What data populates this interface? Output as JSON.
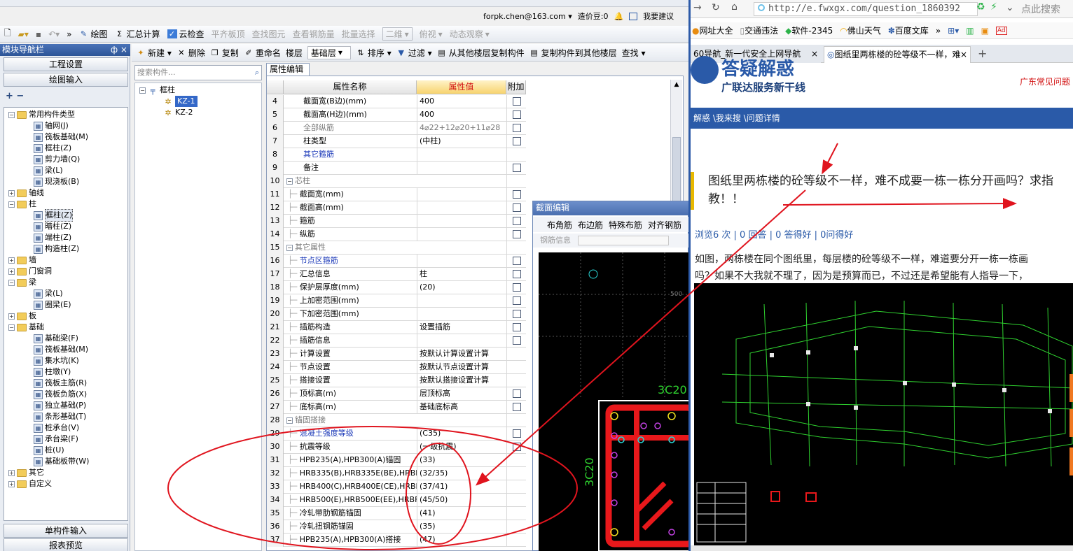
{
  "top_bar": {
    "account": "forpk.chen@163.com ▾",
    "credits": "造价豆:0",
    "suggest": "我要建议"
  },
  "toolbar1": {
    "items": [
      "绘图",
      "汇总计算",
      "云检查",
      "平齐板顶",
      "查找图元",
      "查看钢筋量",
      "批量选择",
      "二维",
      "俯视",
      "动态观察"
    ]
  },
  "nav": {
    "title": "模块导航栏",
    "pin": "ф ×",
    "buttons": [
      "工程设置",
      "绘图输入"
    ],
    "bottom_buttons": [
      "单构件输入",
      "报表预览"
    ],
    "tree": [
      {
        "label": "常用构件类型",
        "level": 0,
        "type": "folder",
        "toggle": "−"
      },
      {
        "label": "轴网(J)",
        "level": 1,
        "type": "item"
      },
      {
        "label": "筏板基础(M)",
        "level": 1,
        "type": "item"
      },
      {
        "label": "框柱(Z)",
        "level": 1,
        "type": "item"
      },
      {
        "label": "剪力墙(Q)",
        "level": 1,
        "type": "item"
      },
      {
        "label": "梁(L)",
        "level": 1,
        "type": "item"
      },
      {
        "label": "现浇板(B)",
        "level": 1,
        "type": "item"
      },
      {
        "label": "轴线",
        "level": 0,
        "type": "folder",
        "toggle": "+"
      },
      {
        "label": "柱",
        "level": 0,
        "type": "folder",
        "toggle": "−"
      },
      {
        "label": "框柱(Z)",
        "level": 1,
        "type": "item",
        "selected": true
      },
      {
        "label": "暗柱(Z)",
        "level": 1,
        "type": "item"
      },
      {
        "label": "端柱(Z)",
        "level": 1,
        "type": "item"
      },
      {
        "label": "构造柱(Z)",
        "level": 1,
        "type": "item"
      },
      {
        "label": "墙",
        "level": 0,
        "type": "folder",
        "toggle": "+"
      },
      {
        "label": "门窗洞",
        "level": 0,
        "type": "folder",
        "toggle": "+"
      },
      {
        "label": "梁",
        "level": 0,
        "type": "folder",
        "toggle": "−"
      },
      {
        "label": "梁(L)",
        "level": 1,
        "type": "item"
      },
      {
        "label": "圈梁(E)",
        "level": 1,
        "type": "item"
      },
      {
        "label": "板",
        "level": 0,
        "type": "folder",
        "toggle": "+"
      },
      {
        "label": "基础",
        "level": 0,
        "type": "folder",
        "toggle": "−"
      },
      {
        "label": "基础梁(F)",
        "level": 1,
        "type": "item"
      },
      {
        "label": "筏板基础(M)",
        "level": 1,
        "type": "item"
      },
      {
        "label": "集水坑(K)",
        "level": 1,
        "type": "item"
      },
      {
        "label": "柱墩(Y)",
        "level": 1,
        "type": "item"
      },
      {
        "label": "筏板主筋(R)",
        "level": 1,
        "type": "item"
      },
      {
        "label": "筏板负筋(X)",
        "level": 1,
        "type": "item"
      },
      {
        "label": "独立基础(P)",
        "level": 1,
        "type": "item"
      },
      {
        "label": "条形基础(T)",
        "level": 1,
        "type": "item"
      },
      {
        "label": "桩承台(V)",
        "level": 1,
        "type": "item"
      },
      {
        "label": "承台梁(F)",
        "level": 1,
        "type": "item"
      },
      {
        "label": "桩(U)",
        "level": 1,
        "type": "item"
      },
      {
        "label": "基础板带(W)",
        "level": 1,
        "type": "item"
      },
      {
        "label": "其它",
        "level": 0,
        "type": "folder",
        "toggle": "+"
      },
      {
        "label": "自定义",
        "level": 0,
        "type": "folder",
        "toggle": "+"
      }
    ]
  },
  "toolbar2": {
    "items": [
      "新建 ▾",
      "删除",
      "复制",
      "重命名",
      "楼层",
      "基础层",
      "排序 ▾",
      "过滤 ▾",
      "从其他楼层复制构件",
      "复制构件到其他楼层",
      "查找 ▾"
    ]
  },
  "search_placeholder": "搜索构件...",
  "component_tree": {
    "root": "框柱",
    "items": [
      "KZ-1",
      "KZ-2"
    ]
  },
  "property_panel": {
    "tab": "属性编辑",
    "headers": [
      "属性名称",
      "属性值",
      "附加"
    ],
    "rows": [
      {
        "n": "4",
        "k": "截面宽(B边)(mm)",
        "v": "400",
        "cb": true
      },
      {
        "n": "5",
        "k": "截面高(H边)(mm)",
        "v": "400",
        "cb": true
      },
      {
        "n": "6",
        "k": "全部纵筋",
        "v": "4⌀22+12⌀20+11⌀28",
        "cb": true,
        "style": "gray"
      },
      {
        "n": "7",
        "k": "柱类型",
        "v": "(中柱)",
        "cb": true
      },
      {
        "n": "8",
        "k": "其它箍筋",
        "v": "",
        "cb": false,
        "style": "blue"
      },
      {
        "n": "9",
        "k": "备注",
        "v": "",
        "cb": true
      },
      {
        "n": "10",
        "k": "芯柱",
        "v": "",
        "cb": false,
        "group": true
      },
      {
        "n": "11",
        "k": "截面宽(mm)",
        "v": "",
        "cb": true,
        "sub": true
      },
      {
        "n": "12",
        "k": "截面高(mm)",
        "v": "",
        "cb": true,
        "sub": true
      },
      {
        "n": "13",
        "k": "箍筋",
        "v": "",
        "cb": true,
        "sub": true
      },
      {
        "n": "14",
        "k": "纵筋",
        "v": "",
        "cb": true,
        "sub": true
      },
      {
        "n": "15",
        "k": "其它属性",
        "v": "",
        "cb": false,
        "group": true
      },
      {
        "n": "16",
        "k": "节点区箍筋",
        "v": "",
        "cb": true,
        "sub": true,
        "style": "blue"
      },
      {
        "n": "17",
        "k": "汇总信息",
        "v": "柱",
        "cb": true,
        "sub": true
      },
      {
        "n": "18",
        "k": "保护层厚度(mm)",
        "v": "(20)",
        "cb": true,
        "sub": true
      },
      {
        "n": "19",
        "k": "上加密范围(mm)",
        "v": "",
        "cb": true,
        "sub": true
      },
      {
        "n": "20",
        "k": "下加密范围(mm)",
        "v": "",
        "cb": true,
        "sub": true
      },
      {
        "n": "21",
        "k": "插筋构造",
        "v": "设置插筋",
        "cb": true,
        "sub": true
      },
      {
        "n": "22",
        "k": "插筋信息",
        "v": "",
        "cb": true,
        "sub": true
      },
      {
        "n": "23",
        "k": "计算设置",
        "v": "按默认计算设置计算",
        "cb": false,
        "sub": true
      },
      {
        "n": "24",
        "k": "节点设置",
        "v": "按默认节点设置计算",
        "cb": false,
        "sub": true
      },
      {
        "n": "25",
        "k": "搭接设置",
        "v": "按默认搭接设置计算",
        "cb": false,
        "sub": true
      },
      {
        "n": "26",
        "k": "顶标高(m)",
        "v": "层顶标高",
        "cb": true,
        "sub": true
      },
      {
        "n": "27",
        "k": "底标高(m)",
        "v": "基础底标高",
        "cb": true,
        "sub": true
      },
      {
        "n": "28",
        "k": "锚固搭接",
        "v": "",
        "cb": false,
        "group": true
      },
      {
        "n": "29",
        "k": "混凝土强度等级",
        "v": "(C35)",
        "cb": true,
        "sub": true,
        "style": "blue"
      },
      {
        "n": "30",
        "k": "抗震等级",
        "v": "(一级抗震)",
        "cb": true,
        "sub": true
      },
      {
        "n": "31",
        "k": "HPB235(A),HPB300(A)锚固",
        "v": "(33)",
        "cb": false,
        "sub": true
      },
      {
        "n": "32",
        "k": "HRB335(B),HRB335E(BE),HRBF",
        "v": "(32/35)",
        "cb": false,
        "sub": true
      },
      {
        "n": "33",
        "k": "HRB400(C),HRB400E(CE),HRBF",
        "v": "(37/41)",
        "cb": false,
        "sub": true
      },
      {
        "n": "34",
        "k": "HRB500(E),HRB500E(EE),HRBF",
        "v": "(45/50)",
        "cb": false,
        "sub": true
      },
      {
        "n": "35",
        "k": "冷轧带肋钢筋锚固",
        "v": "(41)",
        "cb": false,
        "sub": true
      },
      {
        "n": "36",
        "k": "冷轧扭钢筋锚固",
        "v": "(35)",
        "cb": false,
        "sub": true
      },
      {
        "n": "37",
        "k": "HPB235(A),HPB300(A)搭接",
        "v": "(47)",
        "cb": false,
        "sub": true
      }
    ]
  },
  "section_editor": {
    "title": "截面编辑",
    "toolbar": [
      "布角筋",
      "布边筋",
      "特殊布筋",
      "对齐钢筋"
    ],
    "info_label": "钢筋信息",
    "labels": [
      "3C20",
      "3C20",
      "500"
    ]
  },
  "browser": {
    "url": "http://e.fwxgx.com/question_1860392",
    "search_hint": "点此搜索",
    "bookmarks": [
      "网址大全",
      "交通违法",
      "软件-2345",
      "佛山天气",
      "百度文库",
      "»"
    ],
    "tabs": [
      "60导航_新一代安全上网导航",
      "图纸里两栋楼的砼等级不一样，难"
    ],
    "site_slogan": "广联达服务新干线",
    "site_logo": "答疑解惑",
    "site_link": "广东常见问题",
    "nav_text": "解惑 \\我来搜 \\问题详情",
    "question_title": "图纸里两栋楼的砼等级不一样，难不成要一栋一栋分开画吗？求指教！！",
    "stats": "浏览6 次 | 0 回答 | 0 答得好 | 0问得好",
    "body_line1": "如图，两栋楼在同个图纸里，每层楼的砼等级不一样，难道要分开一栋一栋画",
    "body_line2": "吗？如果不大我就不理了，因为是预算而已，不过还是希望能有人指导一下，"
  },
  "colors": {
    "annotation": "#e0141e",
    "cad_bg": "#000000",
    "cad_green": "#2fd12f",
    "rebar_red": "#e8181b",
    "site_blue": "#2a5aa8"
  }
}
